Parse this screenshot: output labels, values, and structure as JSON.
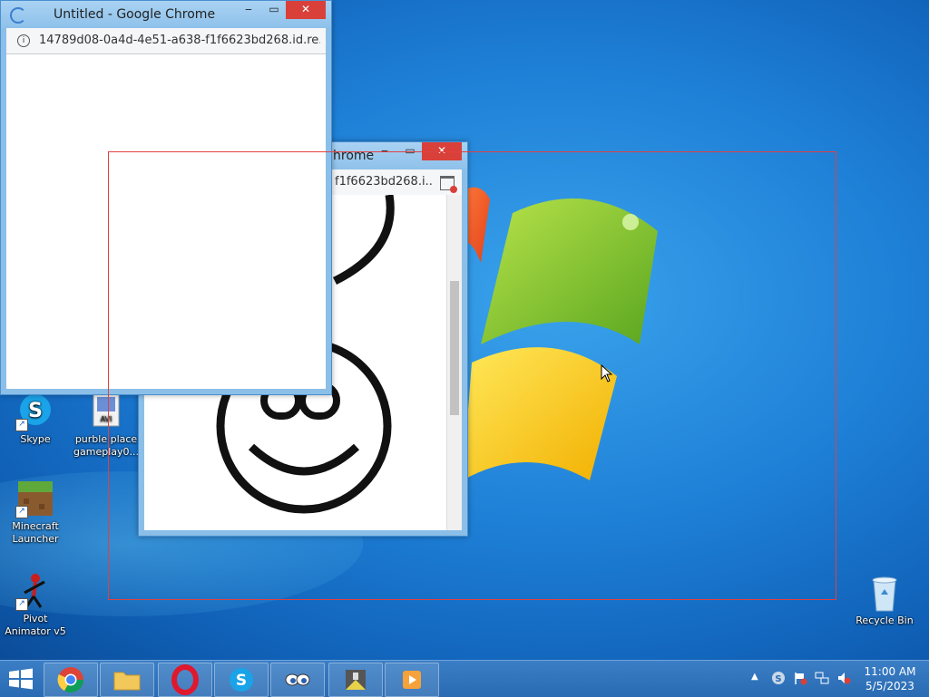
{
  "desktop": {
    "icons": [
      {
        "label": "Skype"
      },
      {
        "label": "purble place gameplay0..."
      },
      {
        "label": "Minecraft Launcher"
      },
      {
        "label": "Pivot Animator v5"
      },
      {
        "label": "Recycle Bin"
      }
    ]
  },
  "window_front": {
    "title": "Untitled - Google Chrome",
    "address": "14789d08-0a4d-4e51-a638-f1f6623bd268.id.re..."
  },
  "window_back": {
    "title_fragment": "hrome",
    "address_fragment": "f1f6623bd268.i..."
  },
  "taskbar": {
    "time": "11:00 AM",
    "date": "5/5/2023"
  },
  "colors": {
    "close_button": "#d9403a",
    "selection": "#e24040",
    "taskbar": "#2a6bb3"
  }
}
